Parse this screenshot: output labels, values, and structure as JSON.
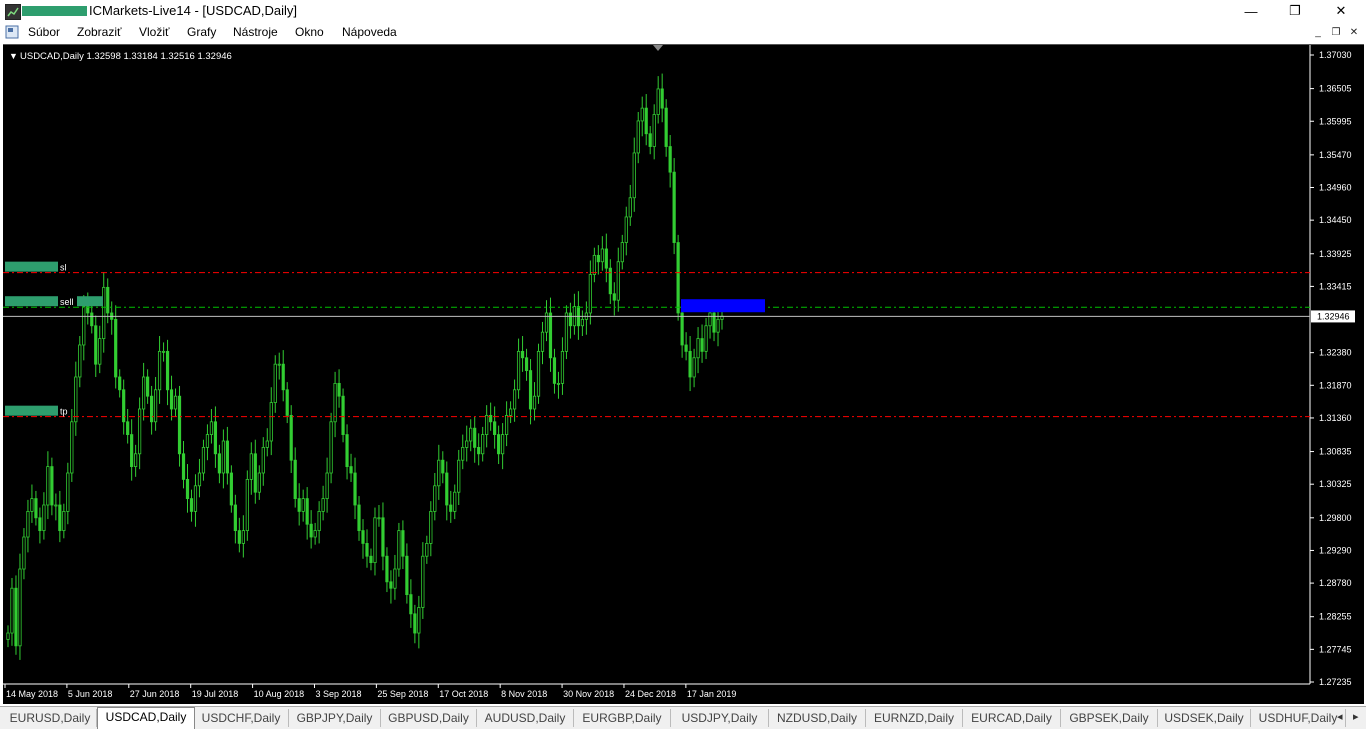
{
  "window": {
    "title": "ICMarkets-Live14 - [USDCAD,Daily]",
    "minimize": "—",
    "maximize": "❐",
    "close": "✕"
  },
  "menu": [
    "Súbor",
    "Zobraziť",
    "Vložiť",
    "Grafy",
    "Nástroje",
    "Okno",
    "Nápoveda"
  ],
  "mdi": {
    "minimize": "_",
    "restore": "❐",
    "close": "✕"
  },
  "chart": {
    "header": "USDCAD,Daily  1.32598 1.33184 1.32516 1.32946",
    "current_price": "1.32946",
    "labels": {
      "sl": "sl",
      "sell": "sell",
      "tp": "tp"
    },
    "colors": {
      "background": "#000000",
      "candles": "#32cd32",
      "sl_line": "#ff0000",
      "tp_line": "#ff0000",
      "sell_line": "#00c000",
      "price_line": "#c0c0c0",
      "highlight_box": "#0000ff"
    }
  },
  "chart_data": {
    "type": "candlestick",
    "symbol": "USDCAD",
    "timeframe": "Daily",
    "ylim": [
      1.27235,
      1.3703
    ],
    "y_ticks": [
      "1.37030",
      "1.36505",
      "1.35995",
      "1.35470",
      "1.34960",
      "1.34450",
      "1.33925",
      "1.33415",
      "1.32946",
      "1.32380",
      "1.31870",
      "1.31360",
      "1.30835",
      "1.30325",
      "1.29800",
      "1.29290",
      "1.28780",
      "1.28255",
      "1.27745",
      "1.27235"
    ],
    "x_ticks": [
      "14 May 2018",
      "5 Jun 2018",
      "27 Jun 2018",
      "19 Jul 2018",
      "10 Aug 2018",
      "3 Sep 2018",
      "25 Sep 2018",
      "17 Oct 2018",
      "8 Nov 2018",
      "30 Nov 2018",
      "24 Dec 2018",
      "17 Jan 2019"
    ],
    "levels": {
      "sl": 1.3363,
      "sell": 1.3309,
      "tp": 1.3138,
      "current": 1.32946
    },
    "close": [
      1.28,
      1.287,
      1.278,
      1.29,
      1.295,
      1.299,
      1.301,
      1.298,
      1.296,
      1.3,
      1.306,
      1.3,
      1.3,
      1.296,
      1.299,
      1.305,
      1.313,
      1.32,
      1.325,
      1.331,
      1.33,
      1.328,
      1.322,
      1.326,
      1.334,
      1.33,
      1.329,
      1.32,
      1.318,
      1.313,
      1.311,
      1.306,
      1.308,
      1.315,
      1.32,
      1.317,
      1.313,
      1.318,
      1.324,
      1.324,
      1.318,
      1.315,
      1.317,
      1.308,
      1.304,
      1.301,
      1.299,
      1.303,
      1.305,
      1.309,
      1.311,
      1.313,
      1.308,
      1.305,
      1.31,
      1.305,
      1.3,
      1.296,
      1.294,
      1.296,
      1.304,
      1.308,
      1.302,
      1.305,
      1.309,
      1.31,
      1.316,
      1.322,
      1.322,
      1.318,
      1.314,
      1.307,
      1.301,
      1.299,
      1.301,
      1.297,
      1.295,
      1.296,
      1.299,
      1.301,
      1.305,
      1.313,
      1.319,
      1.317,
      1.311,
      1.306,
      1.305,
      1.3,
      1.296,
      1.294,
      1.292,
      1.291,
      1.298,
      1.298,
      1.292,
      1.288,
      1.287,
      1.29,
      1.296,
      1.292,
      1.286,
      1.283,
      1.28,
      1.284,
      1.292,
      1.294,
      1.299,
      1.303,
      1.307,
      1.305,
      1.3,
      1.299,
      1.302,
      1.307,
      1.309,
      1.31,
      1.312,
      1.309,
      1.308,
      1.311,
      1.314,
      1.313,
      1.311,
      1.308,
      1.311,
      1.314,
      1.315,
      1.318,
      1.324,
      1.323,
      1.321,
      1.315,
      1.317,
      1.324,
      1.327,
      1.33,
      1.323,
      1.319,
      1.319,
      1.324,
      1.33,
      1.328,
      1.331,
      1.328,
      1.329,
      1.33,
      1.336,
      1.339,
      1.338,
      1.34,
      1.337,
      1.333,
      1.332,
      1.338,
      1.341,
      1.345,
      1.348,
      1.355,
      1.36,
      1.362,
      1.358,
      1.356,
      1.361,
      1.365,
      1.362,
      1.356,
      1.352,
      1.341,
      1.33,
      1.325,
      1.324,
      1.32,
      1.323,
      1.326,
      1.324,
      1.328,
      1.33,
      1.327,
      1.329,
      1.3295
    ]
  },
  "tabs": [
    {
      "label": "EURUSD,Daily",
      "active": false
    },
    {
      "label": "USDCAD,Daily",
      "active": true
    },
    {
      "label": "USDCHF,Daily",
      "active": false
    },
    {
      "label": "GBPJPY,Daily",
      "active": false
    },
    {
      "label": "GBPUSD,Daily",
      "active": false
    },
    {
      "label": "AUDUSD,Daily",
      "active": false
    },
    {
      "label": "EURGBP,Daily",
      "active": false
    },
    {
      "label": "USDJPY,Daily",
      "active": false
    },
    {
      "label": "NZDUSD,Daily",
      "active": false
    },
    {
      "label": "EURNZD,Daily",
      "active": false
    },
    {
      "label": "EURCAD,Daily",
      "active": false
    },
    {
      "label": "GBPSEK,Daily",
      "active": false
    },
    {
      "label": "USDSEK,Daily",
      "active": false
    },
    {
      "label": "USDHUF,Daily",
      "active": false
    }
  ],
  "tab_arrows": {
    "left": "◂",
    "right": "▸"
  }
}
